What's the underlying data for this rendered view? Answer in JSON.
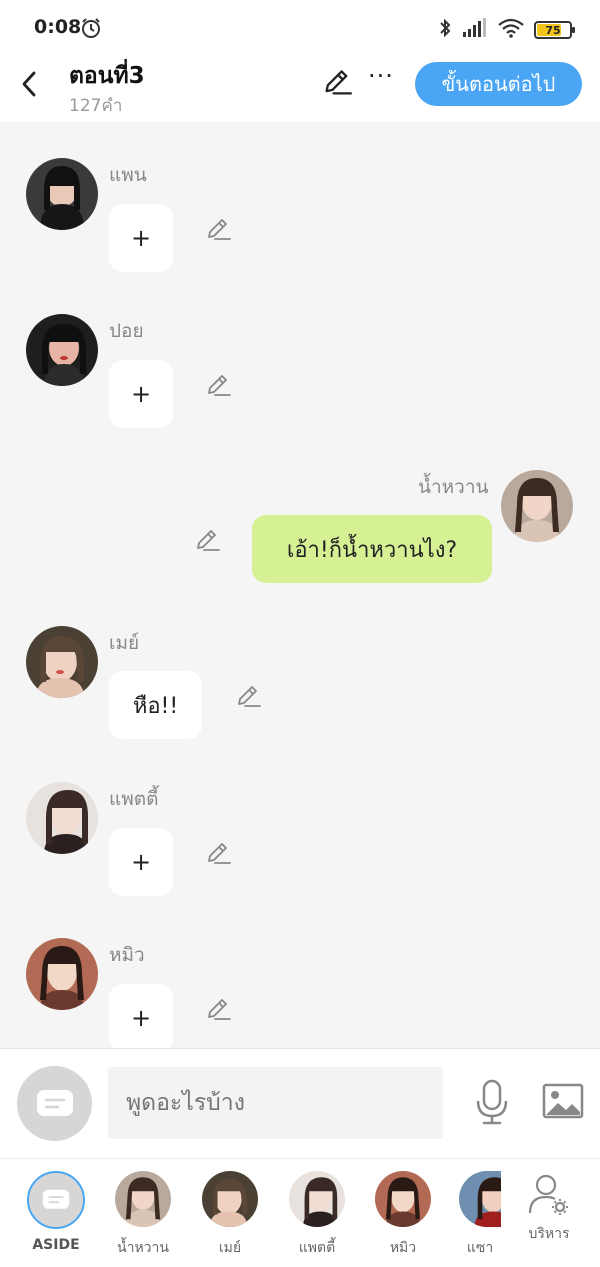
{
  "status_bar": {
    "time": "0:08",
    "battery": "75",
    "battery_level": 0.75
  },
  "header": {
    "title": "ตอนที่3",
    "subtitle": "127คำ",
    "next_label": "ขั้นตอนต่อไป",
    "more_label": "···"
  },
  "messages": [
    {
      "name": "แพน",
      "text": "+",
      "side": "left"
    },
    {
      "name": "ปอย",
      "text": "+",
      "side": "left"
    },
    {
      "name": "น้ำหวาน",
      "text": "เอ้า!ก็น้ำหวานไง?",
      "side": "right"
    },
    {
      "name": "เมย์",
      "text": "หือ!!",
      "side": "left"
    },
    {
      "name": "แพตตี้",
      "text": "+",
      "side": "left"
    },
    {
      "name": "หมิว",
      "text": "+",
      "side": "left"
    }
  ],
  "composer": {
    "placeholder": "พูดอะไรบ้าง"
  },
  "characters": [
    {
      "label": "ASIDE"
    },
    {
      "label": "น้ำหวาน"
    },
    {
      "label": "เมย์"
    },
    {
      "label": "แพตตี้"
    },
    {
      "label": "หมิว"
    },
    {
      "label": "แซา"
    },
    {
      "label": "บริหาร"
    }
  ],
  "colors": {
    "accent": "#4aa6f5",
    "my_bubble": "#d6f094",
    "background": "#f5f5f5"
  }
}
